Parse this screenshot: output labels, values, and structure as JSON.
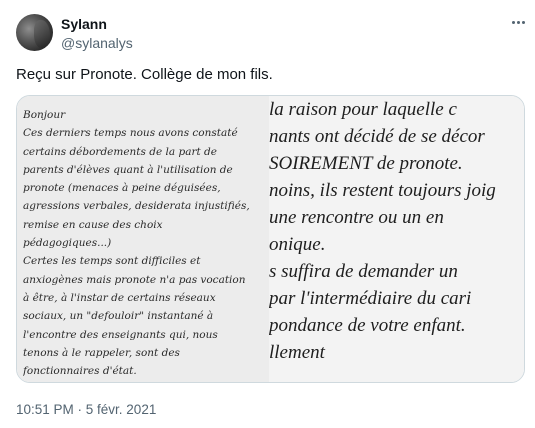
{
  "author": {
    "name": "Sylann",
    "handle": "@sylanalys"
  },
  "tweet": {
    "text": "Reçu sur Pronote. Collège de mon fils.",
    "timestamp": "10:51 PM · 5 févr. 2021"
  },
  "media": {
    "left_lines": [
      "Bonjour",
      "Ces derniers temps nous avons constaté",
      "certains débordements de la part de",
      "parents d'élèves quant à l'utilisation de",
      "pronote (menaces à peine déguisées,",
      "agressions verbales, desiderata injustifiés,",
      "remise en cause des choix",
      "pédagogiques...)",
      "Certes les temps sont difficiles et",
      "anxiogènes mais pronote n'a pas vocation",
      "à être, à l'instar de certains réseaux",
      "sociaux, un \"defouloir\" instantané à",
      "l'encontre des enseignants qui, nous",
      "tenons à le rappeler, sont des",
      "fonctionnaires d'état."
    ],
    "right_lines": [
      "la raison pour laquelle c",
      "nants ont décidé de se décor",
      "SOIREMENT de pronote.",
      "noins, ils restent toujours joig",
      "une rencontre ou un en",
      "onique.",
      "s suffira de demander un",
      "par l'intermédiaire du cari",
      "pondance de votre enfant.",
      "llement"
    ]
  },
  "icons": {
    "more": "more-horizontal-icon",
    "avatar": "avatar"
  }
}
